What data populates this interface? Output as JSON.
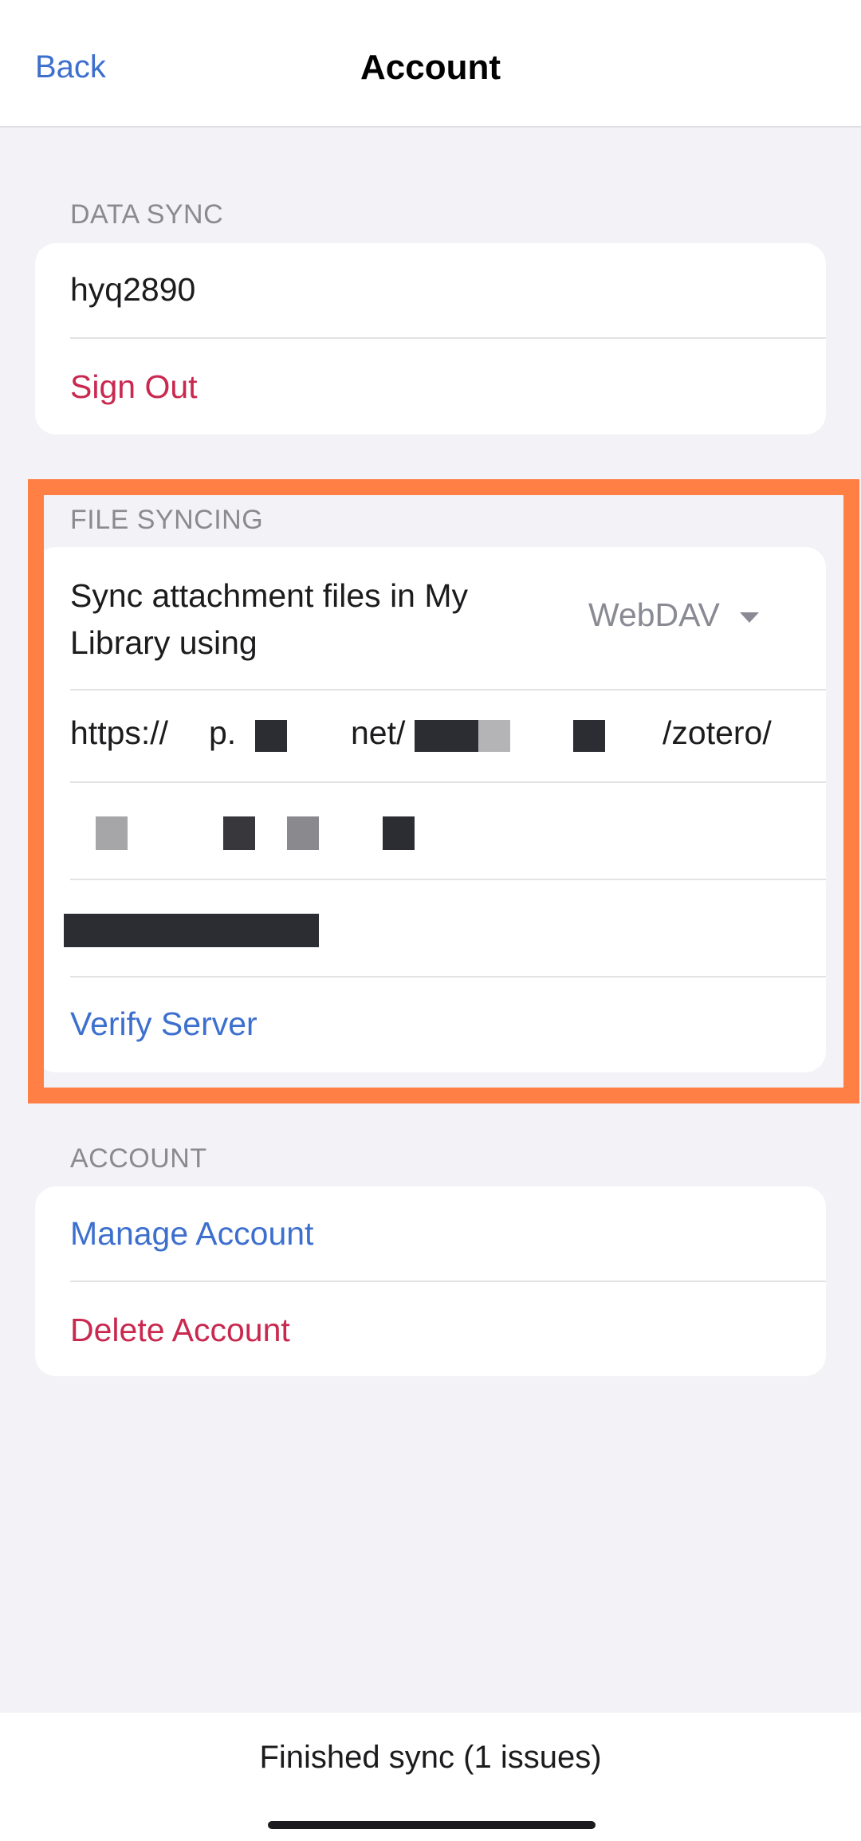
{
  "nav": {
    "back_label": "Back",
    "title": "Account"
  },
  "data_sync": {
    "header": "DATA SYNC",
    "username": "hyq2890",
    "sign_out_label": "Sign Out"
  },
  "file_syncing": {
    "header": "FILE SYNCING",
    "sync_label": "Sync attachment files in My Library using",
    "sync_method": "WebDAV",
    "url_fragments": [
      "https://",
      "p.",
      "net/",
      "/zotero/"
    ],
    "verify_label": "Verify Server",
    "highlight_color": "#ff7f45"
  },
  "account": {
    "header": "ACCOUNT",
    "manage_label": "Manage Account",
    "delete_label": "Delete Account"
  },
  "footer": {
    "status": "Finished sync (1 issues)"
  },
  "colors": {
    "link": "#3d6fce",
    "destructive": "#c9284f",
    "background": "#f2f2f7"
  }
}
